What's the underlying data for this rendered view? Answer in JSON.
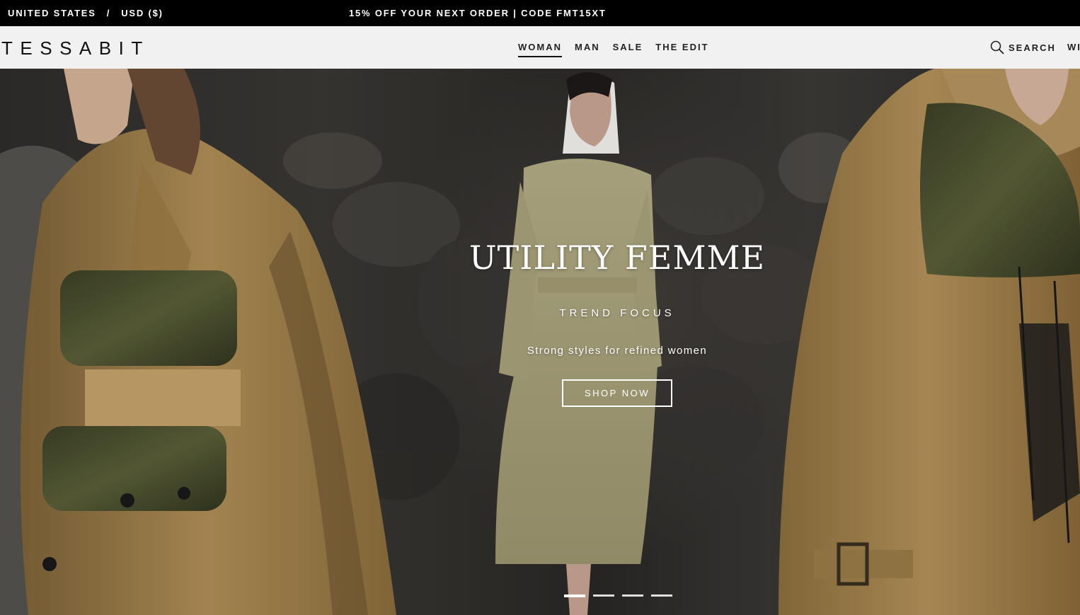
{
  "topbar": {
    "country": "UNITED STATES",
    "separator": "/",
    "currency": "USD ($)",
    "promo": "15% OFF YOUR NEXT ORDER | CODE FMT15XT"
  },
  "header": {
    "logo": "TESSABIT",
    "nav": [
      {
        "label": "WOMAN",
        "active": true
      },
      {
        "label": "MAN",
        "active": false
      },
      {
        "label": "SALE",
        "active": false
      },
      {
        "label": "THE EDIT",
        "active": false
      }
    ],
    "search_label": "SEARCH",
    "wishlist_label_partial": "WI"
  },
  "hero": {
    "title": "UTILITY FEMME",
    "subtitle": "TREND FOCUS",
    "tagline": "Strong styles for refined women",
    "cta": "SHOP NOW",
    "slides": 4,
    "active_slide": 1
  },
  "colors": {
    "topbar_bg": "#000000",
    "header_bg": "#f1f1f1",
    "trench_khaki": "#a88a55",
    "olive": "#4b4f30",
    "text_on_hero": "#ffffff"
  },
  "icons": [
    "search-icon"
  ]
}
